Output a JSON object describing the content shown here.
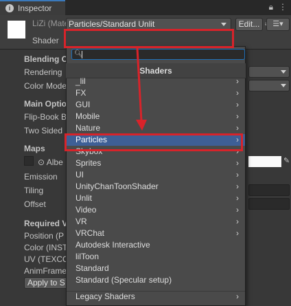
{
  "tab": {
    "title": "Inspector",
    "icon": "info-icon"
  },
  "header": {
    "material_name": "LiZi (Material)",
    "shader_label": "Shader",
    "shader_value": "Particles/Standard Unlit",
    "edit_label": "Edit...",
    "list_icon": "list-icon"
  },
  "background": {
    "blending": "Blending O",
    "rendering": "Rendering",
    "color_mode": "Color Mode",
    "main_options": "Main Optio",
    "flipbook": "Flip-Book B",
    "two_sided": "Two Sided",
    "maps": "Maps",
    "albedo": "Albe",
    "emission": "Emission",
    "tiling": "Tiling",
    "offset": "Offset",
    "required": "Required V",
    "position": "Position (P",
    "color_inst": "Color (INST",
    "uv": "UV (TEXCO",
    "animframe": "AnimFrame",
    "apply": "Apply to S"
  },
  "popup": {
    "title": "Shaders",
    "search_placeholder": "",
    "items": [
      {
        "label": "_lil",
        "submenu": true
      },
      {
        "label": "FX",
        "submenu": true
      },
      {
        "label": "GUI",
        "submenu": true
      },
      {
        "label": "Mobile",
        "submenu": true
      },
      {
        "label": "Nature",
        "submenu": true
      },
      {
        "label": "Particles",
        "submenu": true,
        "selected": true
      },
      {
        "label": "Skybox",
        "submenu": true
      },
      {
        "label": "Sprites",
        "submenu": true
      },
      {
        "label": "UI",
        "submenu": true
      },
      {
        "label": "UnityChanToonShader",
        "submenu": true
      },
      {
        "label": "Unlit",
        "submenu": true
      },
      {
        "label": "Video",
        "submenu": true
      },
      {
        "label": "VR",
        "submenu": true
      },
      {
        "label": "VRChat",
        "submenu": true
      },
      {
        "label": "Autodesk Interactive",
        "submenu": false
      },
      {
        "label": "lilToon",
        "submenu": false
      },
      {
        "label": "Standard",
        "submenu": false
      },
      {
        "label": "Standard (Specular setup)",
        "submenu": false
      },
      {
        "label": "Legacy Shaders",
        "submenu": true
      }
    ]
  },
  "colors": {
    "accent": "#3a79bb",
    "selection": "#3e5f96",
    "annotation": "#d8232a"
  }
}
